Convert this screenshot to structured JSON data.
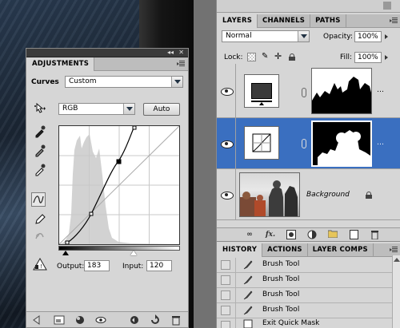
{
  "adjustments": {
    "tab_label": "ADJUSTMENTS",
    "adjustment_name": "Curves",
    "preset_value": "Custom",
    "channel_value": "RGB",
    "auto_label": "Auto",
    "output_label": "Output:",
    "output_value": "183",
    "input_label": "Input:",
    "input_value": "120"
  },
  "layers_panel": {
    "tabs": [
      "LAYERS",
      "CHANNELS",
      "PATHS"
    ],
    "blend_mode": "Normal",
    "opacity_label": "Opacity:",
    "opacity_value": "100%",
    "lock_label": "Lock:",
    "fill_label": "Fill:",
    "fill_value": "100%",
    "layers": [
      {
        "name": ""
      },
      {
        "name": ""
      },
      {
        "name": "Background"
      }
    ]
  },
  "history_panel": {
    "tabs": [
      "HISTORY",
      "ACTIONS",
      "LAYER COMPS"
    ],
    "items": [
      "Brush Tool",
      "Brush Tool",
      "Brush Tool",
      "Brush Tool",
      "Exit Quick Mask"
    ]
  },
  "colors": {
    "panel_bg": "#d6d6d6",
    "selected_layer": "#3a6fc0"
  }
}
